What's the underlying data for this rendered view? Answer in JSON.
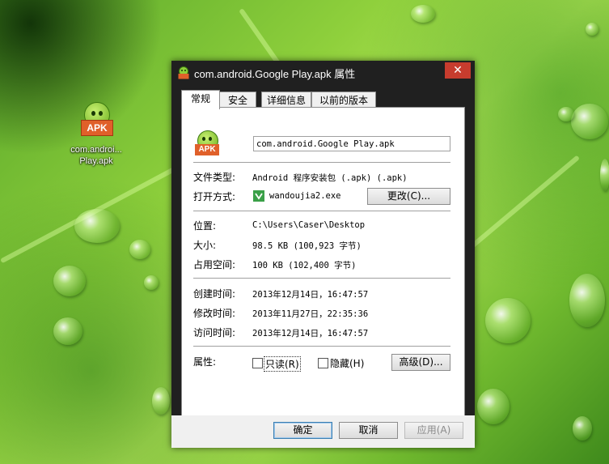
{
  "desktop": {
    "icon_badge": "APK",
    "icon_label_line1": "com.androi...",
    "icon_label_line2": "Play.apk"
  },
  "window": {
    "title": "com.android.Google Play.apk 属性",
    "close_glyph": "✕",
    "tabs": [
      "常规",
      "安全",
      "详细信息",
      "以前的版本"
    ],
    "file_icon_badge": "APK",
    "file_name": "com.android.Google Play.apk",
    "file_type_label": "文件类型:",
    "file_type_value": "Android 程序安装包 (.apk) (.apk)",
    "open_with_label": "打开方式:",
    "open_with_value": "wandoujia2.exe",
    "change_button": "更改(C)...",
    "location_label": "位置:",
    "location_value": "C:\\Users\\Caser\\Desktop",
    "size_label": "大小:",
    "size_value": "98.5 KB (100,923 字节)",
    "disk_size_label": "占用空间:",
    "disk_size_value": "100 KB (102,400 字节)",
    "created_label": "创建时间:",
    "created_value": "2013年12月14日，16:47:57",
    "modified_label": "修改时间:",
    "modified_value": "2013年11月27日，22:35:36",
    "accessed_label": "访问时间:",
    "accessed_value": "2013年12月14日，16:47:57",
    "attributes_label": "属性:",
    "readonly_label": "只读(R)",
    "hidden_label": "隐藏(H)",
    "advanced_button": "高级(D)...",
    "ok_button": "确定",
    "cancel_button": "取消",
    "apply_button": "应用(A)"
  },
  "colors": {
    "close_red": "#c73c2e",
    "window_frame": "#202020",
    "wallpaper_green": "#8fd03c"
  }
}
